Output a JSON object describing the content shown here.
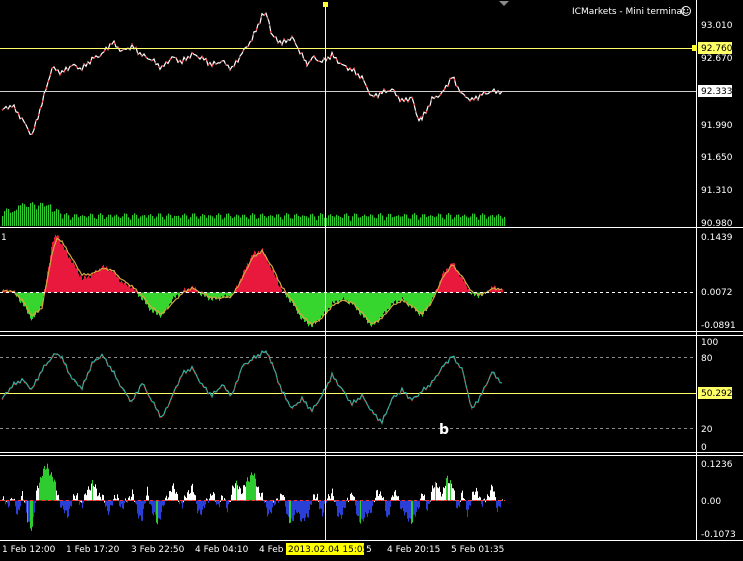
{
  "header": {
    "title": "ICMarkets - Mini terminal",
    "smiley_icon": "smiley-icon"
  },
  "colors": {
    "background": "#000000",
    "frame": "#ffffff",
    "crosshair": "#ffff99",
    "price_line": "#ffff66",
    "up_candle": "#ffffff",
    "down_candle": "#ff2a2a",
    "volume": "#2ecc2e",
    "histogram_pos": "#e8193c",
    "histogram_neg": "#36d62f",
    "signal_line": "#d4a640",
    "oscillator_line": "#2fb8a8",
    "oscillator_signal": "#c8332a",
    "date_highlight_bg": "#ffff00"
  },
  "main_panel": {
    "axis_labels": [
      "93.010",
      "92.670",
      "91.990",
      "91.650",
      "91.310",
      "90.980"
    ],
    "price_badges": [
      "92.760",
      "92.333"
    ]
  },
  "macd_panel": {
    "indicator_label": "1",
    "axis_labels": [
      "0.1439",
      "-0.0891"
    ],
    "current_value": "0.0072"
  },
  "oscillator_panel": {
    "axis_labels": [
      "100",
      "80",
      "20",
      "0"
    ],
    "current_value": "50.292",
    "annotation": "b"
  },
  "histogram_panel": {
    "axis_labels": [
      "0.1236",
      "0.00",
      "-0.1073"
    ]
  },
  "time_axis": {
    "labels": [
      "1 Feb 12:00",
      "1 Feb 17:20",
      "3 Feb 22:50",
      "4 Feb 04:10",
      "4 Feb",
      "4 Feb 20:15",
      "5 Feb 01:35"
    ],
    "crosshair_date": "2013.02.04 15:05",
    "crosshair_suffix": "5"
  },
  "series": {
    "price": [
      [
        0,
        92.14
      ],
      [
        10,
        92.19
      ],
      [
        20,
        92.05
      ],
      [
        30,
        91.88
      ],
      [
        40,
        92.21
      ],
      [
        50,
        92.57
      ],
      [
        60,
        92.52
      ],
      [
        70,
        92.6
      ],
      [
        80,
        92.56
      ],
      [
        90,
        92.66
      ],
      [
        100,
        92.71
      ],
      [
        110,
        92.83
      ],
      [
        120,
        92.74
      ],
      [
        130,
        92.79
      ],
      [
        140,
        92.7
      ],
      [
        150,
        92.65
      ],
      [
        160,
        92.57
      ],
      [
        170,
        92.68
      ],
      [
        180,
        92.63
      ],
      [
        190,
        92.71
      ],
      [
        200,
        92.67
      ],
      [
        210,
        92.6
      ],
      [
        220,
        92.64
      ],
      [
        230,
        92.56
      ],
      [
        240,
        92.72
      ],
      [
        250,
        92.86
      ],
      [
        260,
        93.1
      ],
      [
        265,
        93.12
      ],
      [
        270,
        92.9
      ],
      [
        280,
        92.82
      ],
      [
        290,
        92.88
      ],
      [
        300,
        92.7
      ],
      [
        305,
        92.6
      ],
      [
        310,
        92.68
      ],
      [
        320,
        92.63
      ],
      [
        330,
        92.7
      ],
      [
        340,
        92.6
      ],
      [
        350,
        92.55
      ],
      [
        360,
        92.47
      ],
      [
        370,
        92.27
      ],
      [
        380,
        92.32
      ],
      [
        390,
        92.35
      ],
      [
        400,
        92.23
      ],
      [
        410,
        92.27
      ],
      [
        415,
        92.07
      ],
      [
        420,
        92.05
      ],
      [
        430,
        92.25
      ],
      [
        440,
        92.31
      ],
      [
        450,
        92.48
      ],
      [
        460,
        92.3
      ],
      [
        470,
        92.24
      ],
      [
        480,
        92.3
      ],
      [
        490,
        92.33
      ],
      [
        500,
        92.33
      ]
    ],
    "macd": [
      [
        0,
        0.0
      ],
      [
        10,
        0.002
      ],
      [
        20,
        -0.03
      ],
      [
        30,
        -0.07
      ],
      [
        40,
        -0.03
      ],
      [
        50,
        0.12
      ],
      [
        55,
        0.139
      ],
      [
        60,
        0.11
      ],
      [
        70,
        0.07
      ],
      [
        80,
        0.03
      ],
      [
        90,
        0.04
      ],
      [
        100,
        0.06
      ],
      [
        110,
        0.05
      ],
      [
        120,
        0.02
      ],
      [
        130,
        0.01
      ],
      [
        140,
        -0.02
      ],
      [
        150,
        -0.05
      ],
      [
        160,
        -0.06
      ],
      [
        170,
        -0.02
      ],
      [
        180,
        0.0
      ],
      [
        190,
        0.01
      ],
      [
        200,
        -0.01
      ],
      [
        210,
        -0.02
      ],
      [
        220,
        -0.015
      ],
      [
        230,
        -0.01
      ],
      [
        240,
        0.04
      ],
      [
        250,
        0.09
      ],
      [
        260,
        0.1
      ],
      [
        270,
        0.05
      ],
      [
        280,
        0.0
      ],
      [
        290,
        -0.03
      ],
      [
        300,
        -0.07
      ],
      [
        310,
        -0.085
      ],
      [
        320,
        -0.06
      ],
      [
        330,
        -0.03
      ],
      [
        340,
        -0.02
      ],
      [
        350,
        -0.03
      ],
      [
        360,
        -0.06
      ],
      [
        370,
        -0.085
      ],
      [
        380,
        -0.06
      ],
      [
        390,
        -0.03
      ],
      [
        400,
        -0.02
      ],
      [
        410,
        -0.04
      ],
      [
        420,
        -0.06
      ],
      [
        430,
        -0.02
      ],
      [
        440,
        0.04
      ],
      [
        450,
        0.07
      ],
      [
        460,
        0.03
      ],
      [
        470,
        -0.01
      ],
      [
        480,
        -0.01
      ],
      [
        490,
        0.01
      ],
      [
        500,
        0.005
      ]
    ],
    "macd_signal": [
      [
        0,
        0.0
      ],
      [
        10,
        0.001
      ],
      [
        20,
        -0.02
      ],
      [
        30,
        -0.06
      ],
      [
        40,
        -0.04
      ],
      [
        50,
        0.09
      ],
      [
        55,
        0.13
      ],
      [
        60,
        0.12
      ],
      [
        70,
        0.08
      ],
      [
        80,
        0.04
      ],
      [
        90,
        0.042
      ],
      [
        100,
        0.055
      ],
      [
        110,
        0.052
      ],
      [
        120,
        0.028
      ],
      [
        130,
        0.012
      ],
      [
        140,
        -0.01
      ],
      [
        150,
        -0.04
      ],
      [
        160,
        -0.055
      ],
      [
        170,
        -0.03
      ],
      [
        180,
        -0.005
      ],
      [
        190,
        0.008
      ],
      [
        200,
        -0.004
      ],
      [
        210,
        -0.016
      ],
      [
        220,
        -0.016
      ],
      [
        230,
        -0.012
      ],
      [
        240,
        0.03
      ],
      [
        250,
        0.08
      ],
      [
        260,
        0.098
      ],
      [
        270,
        0.06
      ],
      [
        280,
        0.01
      ],
      [
        290,
        -0.022
      ],
      [
        300,
        -0.06
      ],
      [
        310,
        -0.08
      ],
      [
        320,
        -0.065
      ],
      [
        330,
        -0.036
      ],
      [
        340,
        -0.022
      ],
      [
        350,
        -0.027
      ],
      [
        360,
        -0.052
      ],
      [
        370,
        -0.08
      ],
      [
        380,
        -0.065
      ],
      [
        390,
        -0.036
      ],
      [
        400,
        -0.022
      ],
      [
        410,
        -0.036
      ],
      [
        420,
        -0.055
      ],
      [
        430,
        -0.026
      ],
      [
        440,
        0.03
      ],
      [
        450,
        0.065
      ],
      [
        460,
        0.036
      ],
      [
        470,
        -0.002
      ],
      [
        480,
        -0.008
      ],
      [
        490,
        0.006
      ],
      [
        500,
        0.006
      ]
    ],
    "oscillator": [
      [
        0,
        45
      ],
      [
        10,
        57
      ],
      [
        20,
        63
      ],
      [
        30,
        54
      ],
      [
        40,
        72
      ],
      [
        50,
        84
      ],
      [
        55,
        88
      ],
      [
        60,
        83
      ],
      [
        70,
        64
      ],
      [
        80,
        55
      ],
      [
        90,
        78
      ],
      [
        100,
        86
      ],
      [
        110,
        72
      ],
      [
        120,
        55
      ],
      [
        130,
        42
      ],
      [
        140,
        60
      ],
      [
        150,
        43
      ],
      [
        160,
        27
      ],
      [
        170,
        47
      ],
      [
        180,
        68
      ],
      [
        190,
        74
      ],
      [
        200,
        58
      ],
      [
        210,
        48
      ],
      [
        220,
        58
      ],
      [
        230,
        48
      ],
      [
        240,
        75
      ],
      [
        250,
        82
      ],
      [
        260,
        88
      ],
      [
        265,
        89
      ],
      [
        270,
        78
      ],
      [
        280,
        52
      ],
      [
        290,
        36
      ],
      [
        300,
        45
      ],
      [
        310,
        34
      ],
      [
        320,
        48
      ],
      [
        330,
        67
      ],
      [
        340,
        54
      ],
      [
        350,
        40
      ],
      [
        360,
        48
      ],
      [
        370,
        33
      ],
      [
        380,
        23
      ],
      [
        390,
        45
      ],
      [
        400,
        53
      ],
      [
        410,
        44
      ],
      [
        420,
        52
      ],
      [
        430,
        60
      ],
      [
        440,
        74
      ],
      [
        450,
        85
      ],
      [
        460,
        73
      ],
      [
        470,
        35
      ],
      [
        480,
        50
      ],
      [
        490,
        70
      ],
      [
        500,
        60
      ]
    ],
    "histogram": [
      [
        0,
        0.01
      ],
      [
        5,
        -0.01
      ],
      [
        10,
        0.02
      ],
      [
        15,
        -0.04
      ],
      [
        20,
        0.03
      ],
      [
        25,
        -0.05
      ],
      [
        30,
        -0.08
      ],
      [
        35,
        0.05
      ],
      [
        40,
        0.09
      ],
      [
        45,
        0.11
      ],
      [
        50,
        0.08
      ],
      [
        55,
        0.03
      ],
      [
        60,
        -0.02
      ],
      [
        65,
        -0.04
      ],
      [
        70,
        0.01
      ],
      [
        75,
        0.02
      ],
      [
        80,
        -0.01
      ],
      [
        85,
        0.04
      ],
      [
        90,
        0.06
      ],
      [
        95,
        0.03
      ],
      [
        100,
        0.02
      ],
      [
        105,
        -0.03
      ],
      [
        110,
        0.0
      ],
      [
        115,
        0.02
      ],
      [
        120,
        -0.02
      ],
      [
        125,
        0.01
      ],
      [
        130,
        0.03
      ],
      [
        135,
        -0.03
      ],
      [
        140,
        -0.05
      ],
      [
        145,
        0.04
      ],
      [
        150,
        -0.03
      ],
      [
        155,
        -0.06
      ],
      [
        160,
        -0.02
      ],
      [
        165,
        0.02
      ],
      [
        170,
        0.05
      ],
      [
        175,
        0.02
      ],
      [
        180,
        -0.01
      ],
      [
        185,
        0.03
      ],
      [
        190,
        0.05
      ],
      [
        195,
        -0.02
      ],
      [
        200,
        -0.03
      ],
      [
        205,
        0.01
      ],
      [
        210,
        0.03
      ],
      [
        215,
        -0.01
      ],
      [
        220,
        0.02
      ],
      [
        225,
        -0.02
      ],
      [
        230,
        0.04
      ],
      [
        235,
        0.06
      ],
      [
        240,
        0.03
      ],
      [
        245,
        0.07
      ],
      [
        250,
        0.09
      ],
      [
        255,
        0.05
      ],
      [
        260,
        0.02
      ],
      [
        265,
        -0.03
      ],
      [
        270,
        -0.02
      ],
      [
        275,
        0.01
      ],
      [
        280,
        0.03
      ],
      [
        285,
        -0.04
      ],
      [
        290,
        -0.06
      ],
      [
        295,
        -0.02
      ],
      [
        300,
        -0.06
      ],
      [
        305,
        -0.04
      ],
      [
        310,
        0.01
      ],
      [
        315,
        0.02
      ],
      [
        320,
        -0.04
      ],
      [
        325,
        0.02
      ],
      [
        330,
        0.03
      ],
      [
        335,
        -0.03
      ],
      [
        340,
        -0.04
      ],
      [
        345,
        0.01
      ],
      [
        350,
        0.03
      ],
      [
        355,
        -0.04
      ],
      [
        360,
        -0.06
      ],
      [
        365,
        -0.03
      ],
      [
        370,
        -0.02
      ],
      [
        375,
        0.04
      ],
      [
        380,
        0.02
      ],
      [
        385,
        -0.05
      ],
      [
        390,
        0.02
      ],
      [
        395,
        0.03
      ],
      [
        400,
        -0.03
      ],
      [
        405,
        -0.04
      ],
      [
        410,
        -0.06
      ],
      [
        415,
        -0.02
      ],
      [
        420,
        0.03
      ],
      [
        425,
        -0.02
      ],
      [
        430,
        0.04
      ],
      [
        435,
        0.06
      ],
      [
        440,
        0.02
      ],
      [
        445,
        0.08
      ],
      [
        450,
        0.05
      ],
      [
        455,
        -0.02
      ],
      [
        460,
        0.03
      ],
      [
        465,
        -0.03
      ],
      [
        470,
        0.02
      ],
      [
        475,
        0.04
      ],
      [
        480,
        -0.01
      ],
      [
        485,
        0.02
      ],
      [
        490,
        0.05
      ],
      [
        495,
        -0.02
      ],
      [
        500,
        0.01
      ]
    ]
  }
}
